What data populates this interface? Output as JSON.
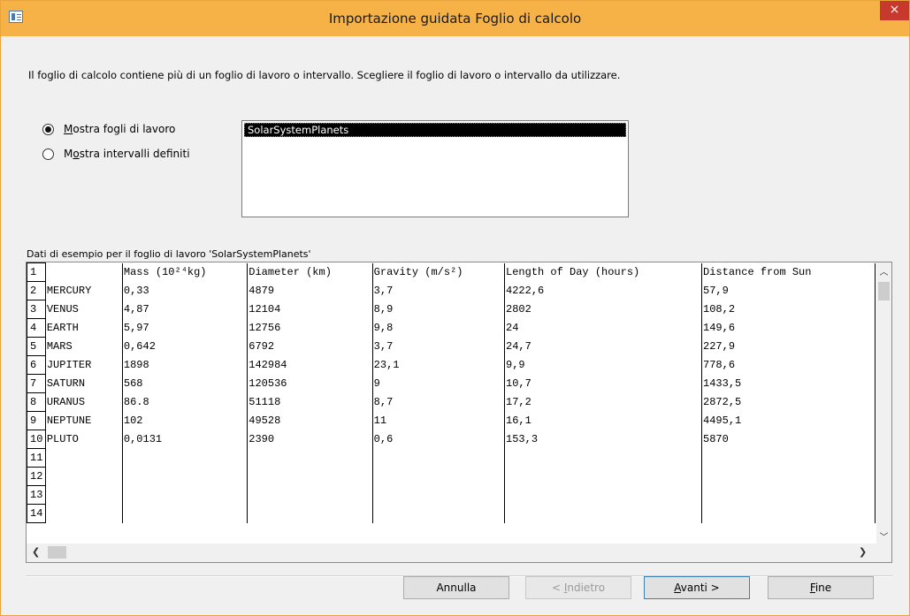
{
  "window": {
    "title": "Importazione guidata Foglio di calcolo",
    "close_glyph": "×"
  },
  "intro_text": "Il foglio di calcolo contiene più di un foglio di lavoro o intervallo. Scegliere il foglio di lavoro o intervallo da utilizzare.",
  "options": {
    "show_sheets": {
      "pre": "",
      "accel": "M",
      "post": "ostra fogli di lavoro",
      "checked": true
    },
    "show_ranges": {
      "pre": "M",
      "accel": "o",
      "post": "stra intervalli definiti",
      "checked": false
    }
  },
  "sheet_list": [
    "SolarSystemPlanets"
  ],
  "sample_label": "Dati di esempio per il foglio di lavoro 'SolarSystemPlanets'",
  "grid": {
    "row_numbers": [
      "1",
      "2",
      "3",
      "4",
      "5",
      "6",
      "7",
      "8",
      "9",
      "10",
      "11",
      "12",
      "13",
      "14"
    ],
    "rows": [
      [
        "",
        "Mass (10²⁴kg)",
        "Diameter (km)",
        "Gravity (m/s²)",
        "Length of Day (hours)",
        "Distance from Sun"
      ],
      [
        "MERCURY",
        "0,33",
        "4879",
        "3,7",
        "4222,6",
        "57,9"
      ],
      [
        "VENUS",
        "4,87",
        "12104",
        "8,9",
        "2802",
        "108,2"
      ],
      [
        "EARTH",
        "5,97",
        "12756",
        "9,8",
        "24",
        "149,6"
      ],
      [
        "MARS",
        "0,642",
        "6792",
        "3,7",
        "24,7",
        "227,9"
      ],
      [
        "JUPITER",
        "1898",
        "142984",
        "23,1",
        "9,9",
        "778,6"
      ],
      [
        "SATURN",
        "568",
        "120536",
        "9",
        "10,7",
        "1433,5"
      ],
      [
        "URANUS",
        "86.8",
        "51118",
        "8,7",
        "17,2",
        "2872,5"
      ],
      [
        "NEPTUNE",
        "102",
        "49528",
        "11",
        "16,1",
        "4495,1"
      ],
      [
        "PLUTO",
        "0,0131",
        "2390",
        "0,6",
        "153,3",
        "5870"
      ],
      [
        "",
        "",
        "",
        "",
        "",
        ""
      ],
      [
        "",
        "",
        "",
        "",
        "",
        ""
      ],
      [
        "",
        "",
        "",
        "",
        "",
        ""
      ],
      [
        "",
        "",
        "",
        "",
        "",
        ""
      ]
    ]
  },
  "buttons": {
    "cancel": "Annulla",
    "back": {
      "pre": "< ",
      "accel": "I",
      "post": "ndietro"
    },
    "next": {
      "pre": "",
      "accel": "A",
      "post": "vanti >"
    },
    "finish": {
      "pre": "",
      "accel": "F",
      "post": "ine"
    }
  },
  "colors": {
    "titlebar": "#f7b247",
    "close": "#c7392d",
    "selection": "#000000"
  }
}
